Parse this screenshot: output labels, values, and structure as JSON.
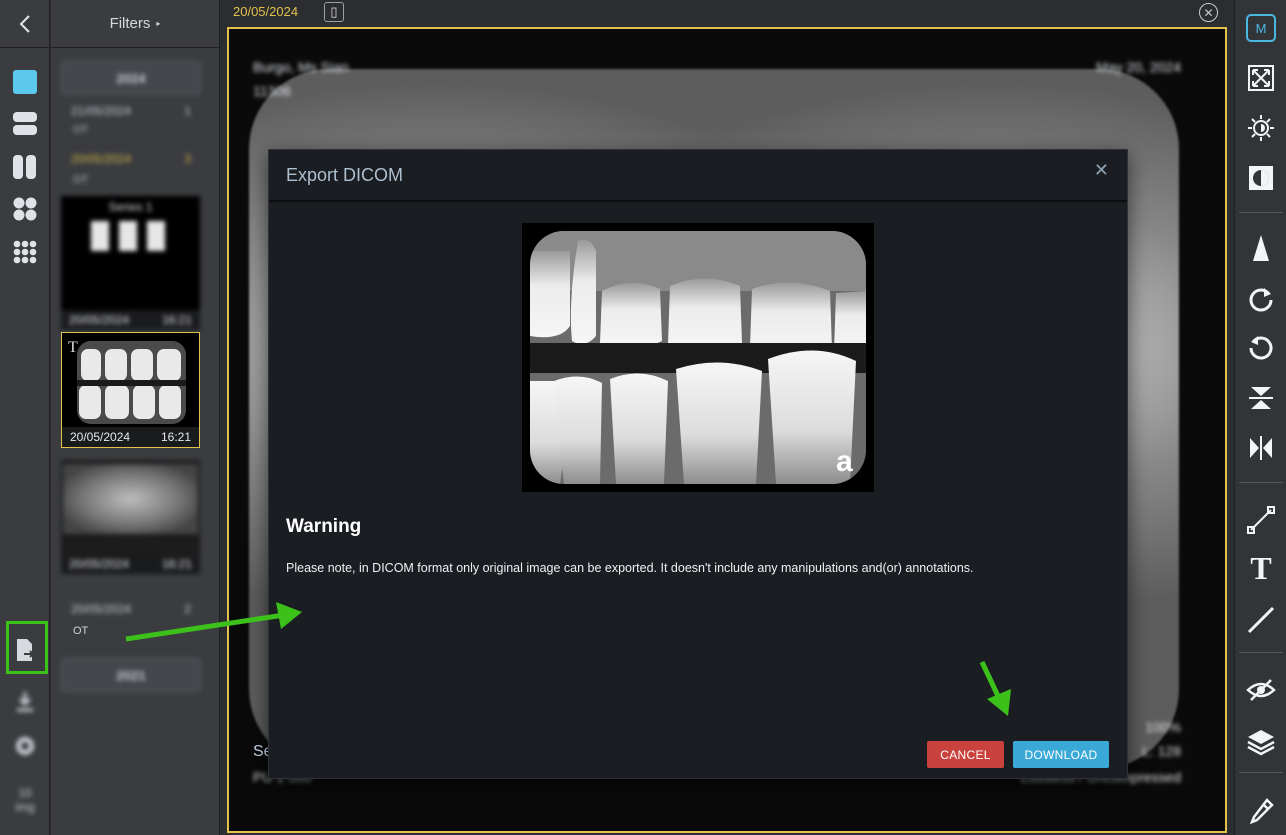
{
  "header": {
    "date": "20/05/2024"
  },
  "filters": {
    "label": "Filters"
  },
  "rail": {
    "items": [
      "single-layout-icon",
      "two-row-layout-icon",
      "two-column-layout-icon",
      "quad-layout-icon",
      "grid-9-layout-icon",
      "export-icon",
      "download-icon",
      "settings-icon"
    ],
    "bottom_count": "10",
    "bottom_label": "img"
  },
  "thumbs": {
    "year_top": "2024",
    "row1_date": "21/05/2024",
    "row1_count": "1",
    "row1_sub": "OT",
    "row2_date": "20/05/2024",
    "row2_count": "3",
    "row2_sub": "OT",
    "series_label": "Series 1",
    "series_foot_date": "20/05/2024",
    "series_foot_time": "16:21",
    "active_date": "20/05/2024",
    "active_time": "16:21",
    "pano_date": "20/05/2024",
    "pano_time": "16:21",
    "row3_date": "20/05/2024",
    "row3_count": "2",
    "row3_sub": "OT",
    "year_bottom": "2021"
  },
  "viewport_overlay": {
    "patient": "Burgo, Ms Sian",
    "id": "11306",
    "date": "May 20, 2024",
    "bottom_left": "Se",
    "bottom_left2": "PU 1 000",
    "bottom_right1": "100%",
    "bottom_right2": "L: 128",
    "bottom_right3": "Lossless / Uncompressed"
  },
  "modal": {
    "title": "Export DICOM",
    "warning_title": "Warning",
    "warning_text": "Please note, in DICOM format only original image can be exported. It doesn't include any manipulations and(or) annotations.",
    "cancel": "CANCEL",
    "download": "DOWNLOAD",
    "watermark": "a"
  },
  "toolbar": {
    "user_initial": "M",
    "tools": [
      "fit-screen-icon",
      "brightness-icon",
      "contrast-icon",
      "sharpen-icon",
      "rotate-cw-icon",
      "rotate-ccw-icon",
      "flip-vertical-icon",
      "flip-horizontal-icon",
      "measure-line-icon",
      "text-icon",
      "line-icon",
      "hide-annotations-icon",
      "layers-icon",
      "color-picker-icon"
    ]
  },
  "colors": {
    "accent": "#e2c24a",
    "annotation": "#3cc11a",
    "download": "#3aa9d8",
    "cancel": "#c9423d"
  }
}
